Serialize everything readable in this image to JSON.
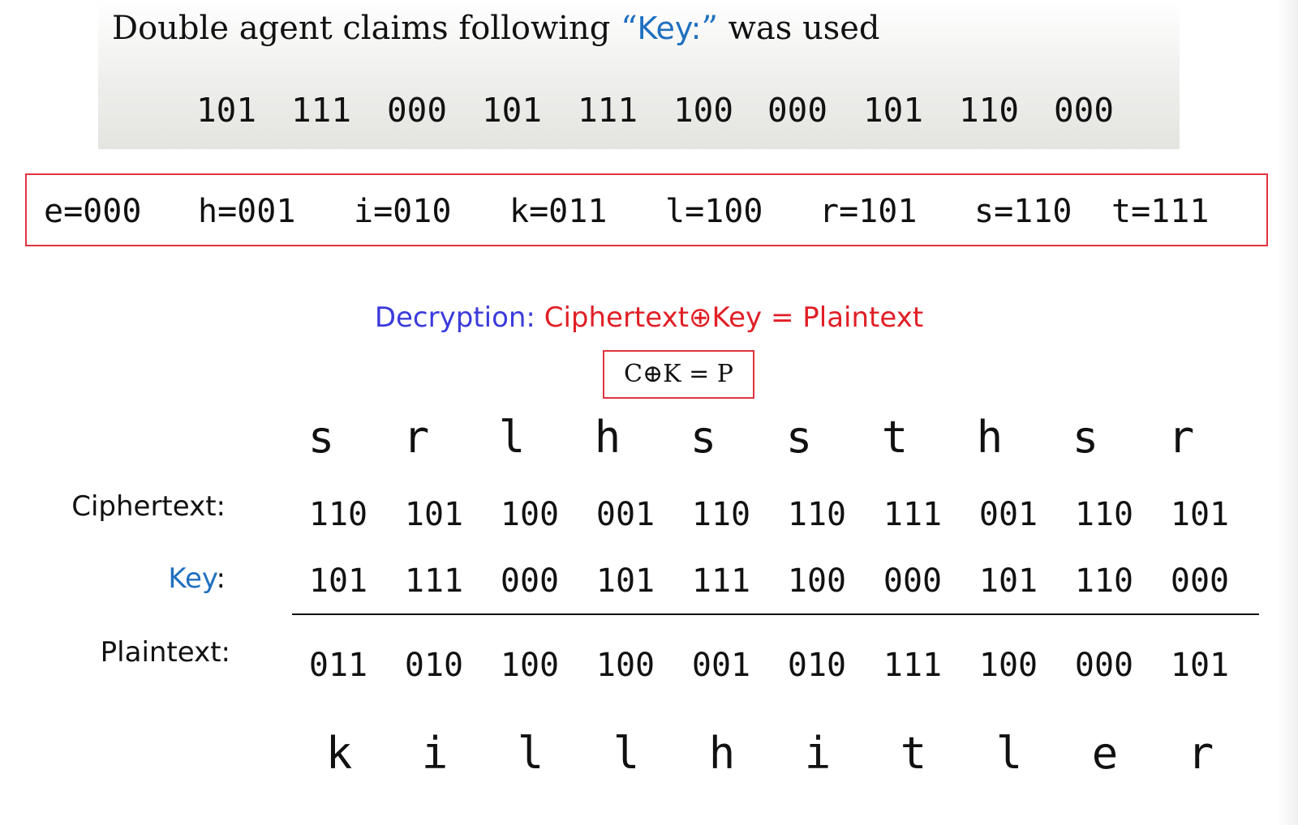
{
  "banner": {
    "title_prefix": "Double agent claims following ",
    "open_quote": "“",
    "key_word": "Key:",
    "close_quote": "”",
    "title_suffix": " was used",
    "key_groups": [
      "101",
      "111",
      "000",
      "101",
      "111",
      "100",
      "000",
      "101",
      "110",
      "000"
    ]
  },
  "encoding": [
    "e=000",
    "h=001",
    "i=010",
    "k=011",
    "l=100",
    "r=101",
    "s=110",
    "t=111"
  ],
  "formula": {
    "label": "Decryption:",
    "ciphertext": "Ciphertext",
    "xor_symbol": "⊕",
    "rest": "Key = Plaintext",
    "boxed": "C⊕K = P"
  },
  "table": {
    "cipher_letters": [
      "s",
      "r",
      "l",
      "h",
      "s",
      "s",
      "t",
      "h",
      "s",
      "r"
    ],
    "ciphertext_label": "Ciphertext:",
    "ciphertext_bits": [
      "110",
      "101",
      "100",
      "001",
      "110",
      "110",
      "111",
      "001",
      "110",
      "101"
    ],
    "key_label": "Key",
    "key_colon": ":",
    "key_bits": [
      "101",
      "111",
      "000",
      "101",
      "111",
      "100",
      "000",
      "101",
      "110",
      "000"
    ],
    "plaintext_label": "Plaintext:",
    "plaintext_bits": [
      "011",
      "010",
      "100",
      "100",
      "001",
      "010",
      "111",
      "100",
      "000",
      "101"
    ],
    "plain_letters": [
      "k",
      "i",
      "l",
      "l",
      "h",
      "i",
      "t",
      "l",
      "e",
      "r"
    ]
  }
}
